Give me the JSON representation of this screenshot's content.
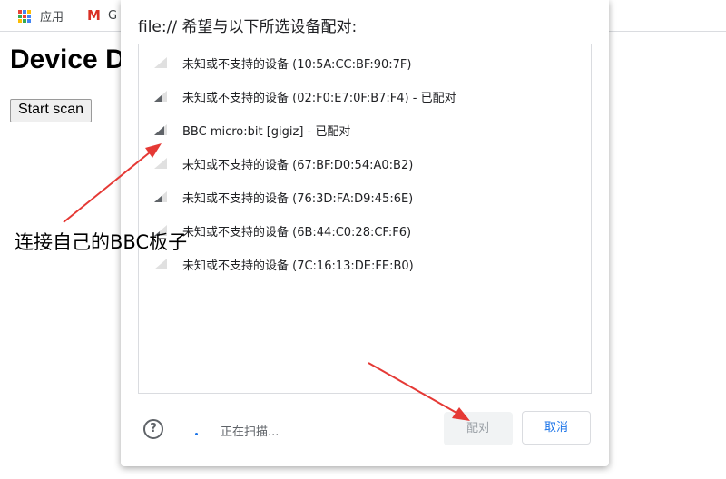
{
  "bookmarks": {
    "apps_label": "应用",
    "gmail_letter": "M",
    "gmail_label": "G"
  },
  "page": {
    "title": "Device D",
    "scan_button": "Start scan"
  },
  "dialog": {
    "title": "file:// 希望与以下所选设备配对:",
    "devices": [
      {
        "name": "未知或不支持的设备 (10:5A:CC:BF:90:7F)"
      },
      {
        "name": "未知或不支持的设备 (02:F0:E7:0F:B7:F4) - 已配对"
      },
      {
        "name": "BBC micro:bit [gigiz] - 已配对"
      },
      {
        "name": "未知或不支持的设备 (67:BF:D0:54:A0:B2)"
      },
      {
        "name": "未知或不支持的设备 (76:3D:FA:D9:45:6E)"
      },
      {
        "name": "未知或不支持的设备 (6B:44:C0:28:CF:F6)"
      },
      {
        "name": "未知或不支持的设备 (7C:16:13:DE:FE:B0)"
      }
    ],
    "help_icon": "?",
    "status": "正在扫描...",
    "pair_button": "配对",
    "cancel_button": "取消"
  },
  "annotation": {
    "text": "连接自己的BBC板子"
  },
  "colors": {
    "accent": "#1a73e8",
    "arrow": "#e53935"
  }
}
